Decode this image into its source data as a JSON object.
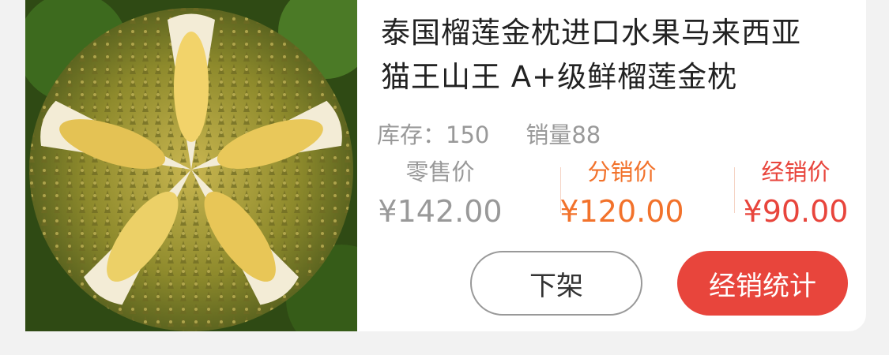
{
  "product": {
    "title_line1": "泰国榴莲金枕进口水果马来西亚",
    "title_line2": "猫王山王 A+级鲜榴莲金枕",
    "stock_label": "库存：150",
    "sales_label": "销量88",
    "image_icon": "durian-photo"
  },
  "prices": {
    "retail": {
      "label": "零售价",
      "value": "¥142.00"
    },
    "distribution": {
      "label": "分销价",
      "value": "¥120.00"
    },
    "dealer": {
      "label": "经销价",
      "value": "¥90.00"
    }
  },
  "actions": {
    "delist_label": "下架",
    "stats_label": "经销统计"
  },
  "colors": {
    "accent_red": "#e8453c",
    "accent_orange": "#f2722b",
    "muted_gray": "#999999"
  }
}
